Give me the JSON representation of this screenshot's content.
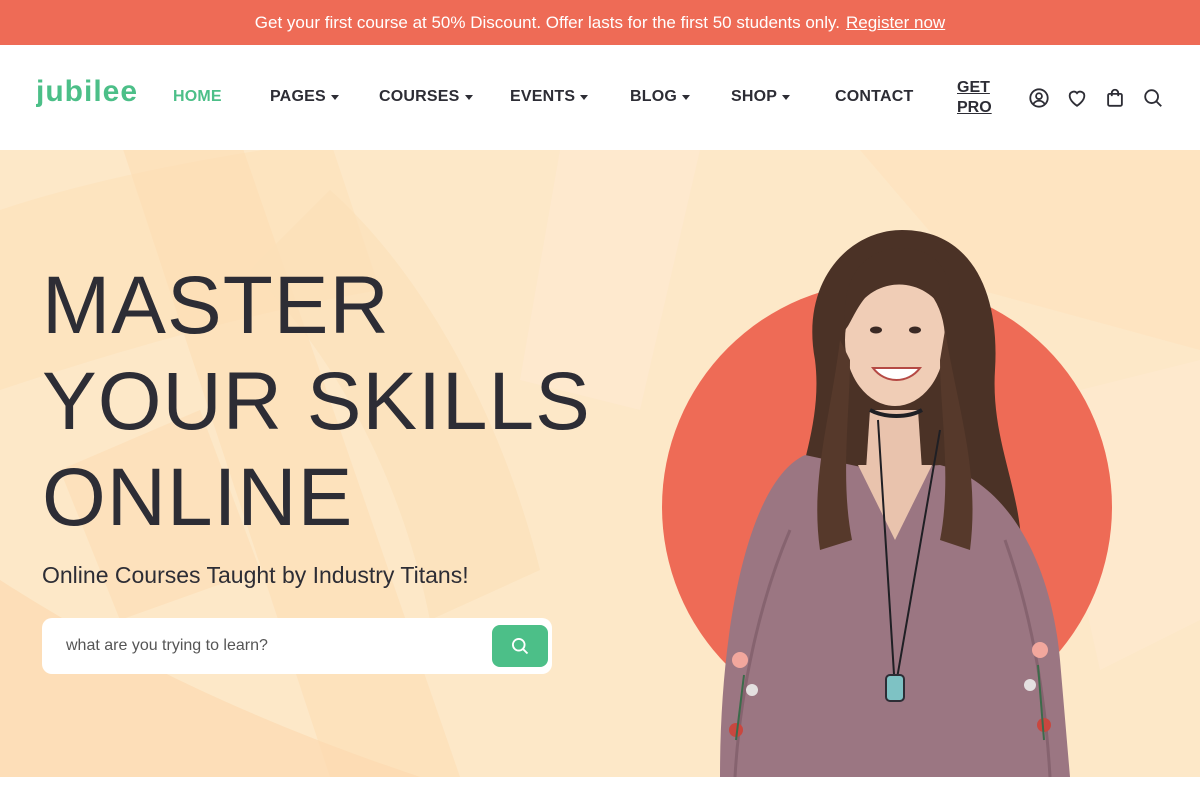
{
  "announcement": {
    "text": "Get your first course at 50% Discount. Offer lasts for the first 50 students only.",
    "link_label": "Register now"
  },
  "header": {
    "logo_text": "jubilee",
    "nav": [
      {
        "label": "HOME",
        "active": true,
        "has_dropdown": false
      },
      {
        "label": "PAGES",
        "active": false,
        "has_dropdown": true
      },
      {
        "label": "COURSES",
        "active": false,
        "has_dropdown": true
      },
      {
        "label": "EVENTS",
        "active": false,
        "has_dropdown": true
      },
      {
        "label": "BLOG",
        "active": false,
        "has_dropdown": true
      },
      {
        "label": "SHOP",
        "active": false,
        "has_dropdown": true
      },
      {
        "label": "CONTACT",
        "active": false,
        "has_dropdown": false
      }
    ],
    "cta_line1": "GET",
    "cta_line2": "PRO",
    "icons": [
      "user-icon",
      "heart-icon",
      "shopping-bag-icon",
      "search-icon"
    ]
  },
  "hero": {
    "headline_lines": [
      "MASTER",
      "YOUR SKILLS",
      "ONLINE"
    ],
    "subtitle": "Online Courses Taught by Industry Titans!",
    "search_placeholder": "what are you trying to learn?",
    "search_value": ""
  },
  "colors": {
    "accent_green": "#4cbf88",
    "coral": "#ee6b56",
    "hero_background": "#fde8c8",
    "text_dark": "#2d2d35"
  }
}
